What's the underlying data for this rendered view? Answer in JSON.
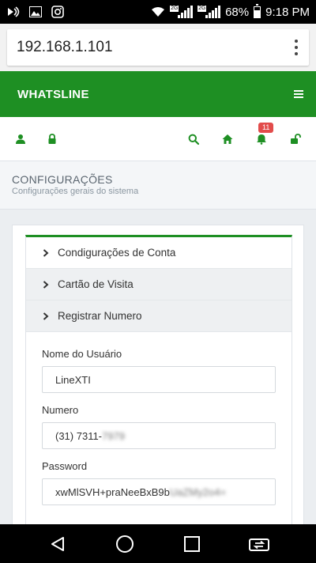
{
  "status_bar": {
    "battery": "68%",
    "time": "9:18 PM",
    "network_tag_1": "2G",
    "network_tag_2": "2G",
    "icons": [
      "notification-icon",
      "image-icon",
      "instagram-icon",
      "wifi-icon",
      "signal-icon",
      "signal-icon",
      "battery-icon"
    ]
  },
  "browser": {
    "url": "192.168.1.101",
    "menu_icon": "kebab-icon"
  },
  "app": {
    "brand": "WHATSLINE",
    "accent_color": "#1e8f23",
    "menu_icon": "hamburger-icon"
  },
  "iconbar": {
    "left_icons": [
      "user-icon",
      "lock-icon"
    ],
    "right_icons": [
      "search-icon",
      "home-icon",
      "bell-icon",
      "unlock-icon"
    ],
    "notification_count": "11"
  },
  "header": {
    "title": "CONFIGURAÇÕES",
    "subtitle": "Configurações gerais do sistema"
  },
  "accordion": [
    {
      "label": "Condigurações de Conta"
    },
    {
      "label": "Cartão de Visita"
    },
    {
      "label": "Registrar Numero"
    }
  ],
  "form": {
    "username": {
      "label": "Nome do Usuário",
      "value": "LineXTI"
    },
    "number": {
      "label": "Numero",
      "value_visible": "(31) 7311-",
      "value_blurred": "7979"
    },
    "password": {
      "label": "Password",
      "value_visible": "xwMlSVH+praNeeBxB9b",
      "value_blurred": "UaZMy2o4="
    }
  },
  "nav_bar": {
    "icons": [
      "back-icon",
      "home-circle-icon",
      "recents-icon",
      "switch-app-icon"
    ]
  }
}
